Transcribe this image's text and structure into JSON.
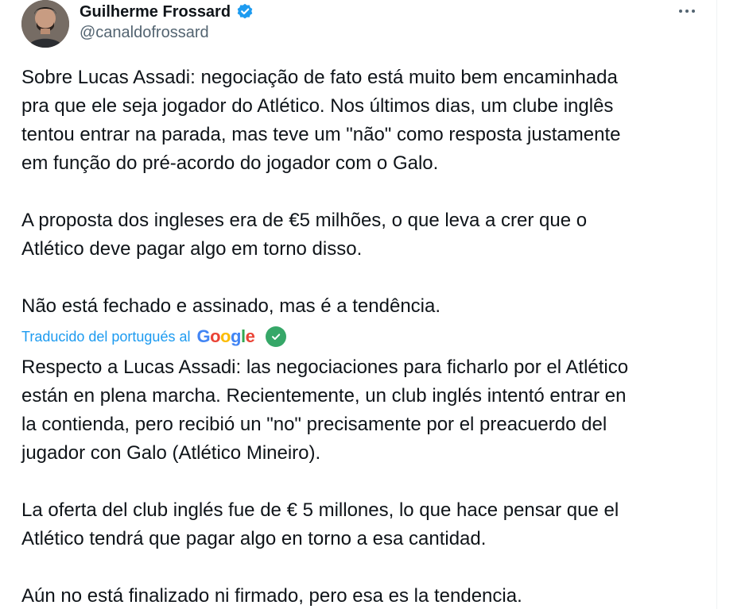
{
  "author": {
    "display_name": "Guilherme Frossard",
    "handle": "@canaldofrossard",
    "verified": true,
    "avatar_icon": "profile-photo"
  },
  "menu": {
    "icon": "more-horizontal-icon"
  },
  "tweet": {
    "original_text": "Sobre Lucas Assadi: negociação de fato está muito bem encaminhada\npra que ele seja jogador do Atlético. Nos últimos dias, um clube inglês\ntentou entrar na parada, mas teve um \"não\" como resposta justamente\nem função do pré-acordo do jogador com o Galo.\n\nA proposta dos ingleses era de €5 milhões, o que leva a crer que o\nAtlético deve pagar algo em torno disso.\n\nNão está fechado e assinado, mas é a tendência.",
    "translation_label": "Traducido del portugués al",
    "translation_provider": "Google",
    "translated_text": "Respecto a Lucas Assadi: las negociaciones para ficharlo por el Atlético\nestán en plena marcha. Recientemente, un club inglés intentó entrar en\nla contienda, pero recibió un \"no\" precisamente por el preacuerdo del\njugador con Galo (Atlético Mineiro).\n\nLa oferta del club inglés fue de € 5 millones, lo que hace pensar que el\nAtlético tendrá que pagar algo en torno a esa cantidad.\n\nAún no está finalizado ni firmado, pero esa es la tendencia."
  },
  "colors": {
    "text": "#0f1419",
    "secondary_text": "#536471",
    "link": "#1d9bf0",
    "verified_badge": "#1d9bf0",
    "translation_check": "#36a768"
  }
}
